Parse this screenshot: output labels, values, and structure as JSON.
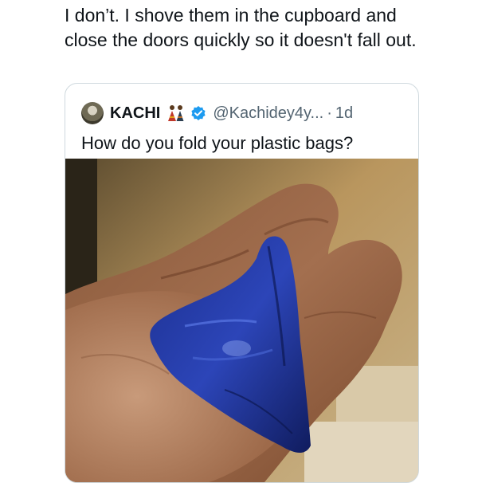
{
  "reply": {
    "text": "I don’t. I shove them in the cupboard and close the doors quickly so it doesn't fall out."
  },
  "quote": {
    "display_name": "KACHI",
    "handle": "@Kachidey4y...",
    "separator": "·",
    "time": "1d",
    "text": "How do you fold your plastic bags?",
    "icons": {
      "avatar": "profile-photo",
      "emoji": "people-in-traditional-attire-emoji",
      "verified": "verified-badge-icon"
    }
  },
  "colors": {
    "text_primary": "#0f1419",
    "text_secondary": "#536471",
    "card_border": "#cfd9de",
    "verified_blue": "#1d9bf0",
    "bag_blue": "#1c2f8f"
  }
}
